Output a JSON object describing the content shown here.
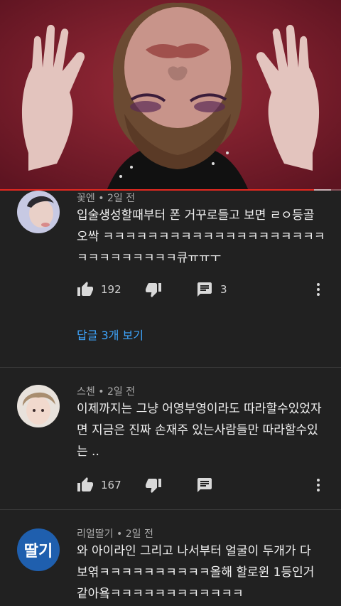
{
  "video": {
    "progress_fraction": 0.92,
    "buffer_fraction": 0.97
  },
  "comments": [
    {
      "author": "꽃엔",
      "time": "2일 전",
      "text": "입술생성할때부터 폰 거꾸로들고 보면 ㄹㅇ등골오싹 ㅋㅋㅋㅋㅋㅋㅋㅋㅋㅋㅋㅋㅋㅋㅋㅋㅋㅋㅋㅋㅋㅋㅋㅋㅋㅋㅋㅋㅋ큐ㅠㅠㅜ",
      "likes": "192",
      "reply_count": "3",
      "view_replies": "답글 3개 보기"
    },
    {
      "author": "스첸",
      "time": "2일 전",
      "text": "이제까지는 그냥 어영부영이라도 따라할수있었자면 지금은 진짜 손재주 있는사람들만 따라할수있는 ..",
      "likes": "167"
    },
    {
      "author": "리얼딸기",
      "time": "2일 전",
      "avatar_text": "딸기",
      "text": "와 아이라인 그리고 나서부터 얼굴이 두개가 다 보엮ㅋㅋㅋㅋㅋㅋㅋㅋㅋㅋ올해 할로윈 1등인거 같아욬ㅋㅋㅋㅋㅋㅋㅋㅋㅋㅋㅋㅋ"
    }
  ],
  "icons": [
    "like-icon",
    "dislike-icon",
    "reply-icon",
    "more-vert-icon"
  ],
  "colors": {
    "background": "#212121",
    "accent_link": "#3ea6ff",
    "progress": "#e52920",
    "avatar_blue": "#1f5fae"
  }
}
